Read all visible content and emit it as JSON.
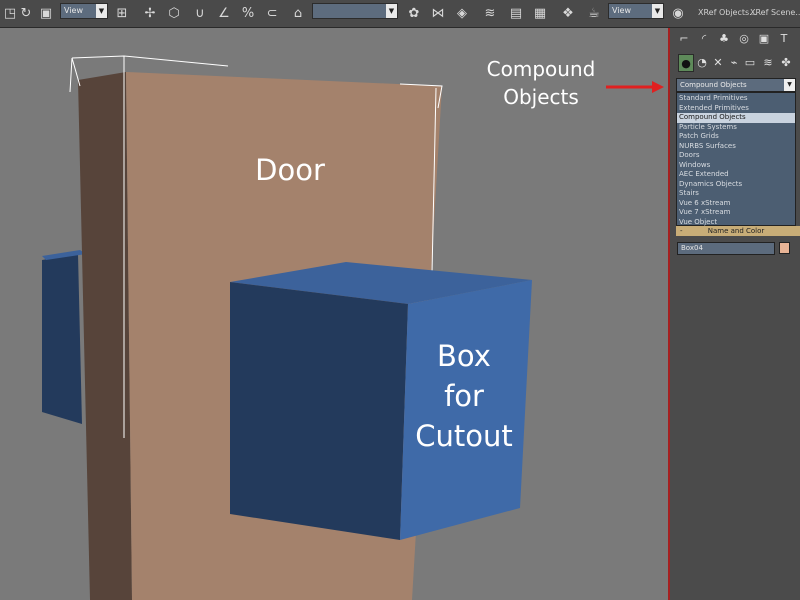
{
  "toolbar": {
    "reference_coord_label": "View",
    "pivot_view_label": "View",
    "named_selection_value": "",
    "xref_objects_label": "XRef Objects...",
    "xref_scene_label": "XRef Scene...",
    "icons": [
      "undo-icon",
      "select-region-icon",
      "select-move-icon",
      "select-rotate-icon",
      "select-scale-icon",
      "snap-3d-icon",
      "angle-snap-icon",
      "percent-snap-icon",
      "spinner-snap-icon",
      "named-sets-icon",
      "mirror-icon",
      "align-icon",
      "layer-manager-icon",
      "curve-editor-icon",
      "schematic-icon",
      "material-editor-icon",
      "render-setup-icon",
      "render-icon"
    ]
  },
  "viewport": {
    "door_label": "Door",
    "box_label_lines": [
      "Box",
      "for",
      "Cutout"
    ],
    "background_color": "#7a7a7a",
    "door_color": "#a4826c",
    "door_side_color": "#57443a",
    "box_front_color": "#233a5c",
    "box_side_color": "#3f6aa8",
    "box_top_color": "#3c629b"
  },
  "annotations": {
    "callout_lines": [
      "Compound",
      "Objects"
    ],
    "arrow_color": "#e02020"
  },
  "command_panel": {
    "tabs": [
      "create-icon",
      "modify-icon",
      "hierarchy-icon",
      "motion-icon",
      "display-icon",
      "utilities-icon"
    ],
    "subtabs": [
      "geometry-icon",
      "shapes-icon",
      "lights-icon",
      "cameras-icon",
      "helpers-icon",
      "space-warps-icon",
      "systems-icon"
    ],
    "category_selected": "Compound Objects",
    "categories": [
      "Standard Primitives",
      "Extended Primitives",
      "Compound Objects",
      "Particle Systems",
      "Patch Grids",
      "NURBS Surfaces",
      "Doors",
      "Windows",
      "AEC Extended",
      "Dynamics Objects",
      "Stairs",
      "Vue 6 xStream",
      "Vue 7 xStream",
      "Vue Object"
    ],
    "rollout": {
      "minus": "-",
      "title": "Name and Color"
    },
    "object_name": "Box04",
    "object_color": "#e8b496"
  }
}
